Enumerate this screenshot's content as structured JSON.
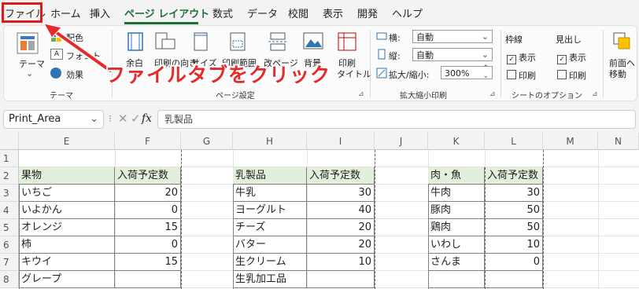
{
  "menu": {
    "tabs": [
      "ファイル",
      "ホーム",
      "挿入",
      "ページ レイアウト",
      "数式",
      "データ",
      "校閲",
      "表示",
      "開発",
      "ヘルプ"
    ],
    "active_tab": "ページ レイアウト"
  },
  "ribbon": {
    "themes": {
      "theme": "テーマ",
      "colors": "配色",
      "fonts": "フォント",
      "effects": "効果",
      "group": "テーマ"
    },
    "page_setup": {
      "margins": "余白",
      "orientation": "印刷の向き",
      "size": "サイズ",
      "print_area": "印刷範囲",
      "breaks": "改ページ",
      "background": "背景",
      "print_titles_1": "印刷",
      "print_titles_2": "タイトル",
      "group": "ページ設定"
    },
    "scale": {
      "width_label": "横:",
      "width_value": "自動",
      "height_label": "縦:",
      "height_value": "自動",
      "scale_label": "拡大/縮小:",
      "scale_value": "300%",
      "group": "拡大縮小印刷"
    },
    "sheet_options": {
      "gridlines": "枠線",
      "headings": "見出し",
      "view": "表示",
      "print": "印刷",
      "group": "シートのオプション"
    },
    "arrange": {
      "bring_forward_1": "前面へ",
      "bring_forward_2": "移動"
    }
  },
  "formula_bar": {
    "name_box": "Print_Area",
    "fx": "fx",
    "content": "乳製品"
  },
  "grid": {
    "columns": [
      "E",
      "F",
      "G",
      "H",
      "I",
      "J",
      "K",
      "L",
      "M",
      "N"
    ],
    "rows": [
      "1",
      "2",
      "3",
      "4",
      "5",
      "6",
      "7",
      "8"
    ],
    "table_fruit": {
      "headers": [
        "果物",
        "入荷予定数"
      ],
      "rows": [
        [
          "いちご",
          "20"
        ],
        [
          "いよかん",
          "0"
        ],
        [
          "オレンジ",
          "15"
        ],
        [
          "柿",
          "0"
        ],
        [
          "キウイ",
          "15"
        ],
        [
          "グレープ",
          ""
        ]
      ]
    },
    "table_dairy": {
      "headers": [
        "乳製品",
        "入荷予定数"
      ],
      "rows": [
        [
          "牛乳",
          "30"
        ],
        [
          "ヨーグルト",
          "40"
        ],
        [
          "チーズ",
          "20"
        ],
        [
          "バター",
          "20"
        ],
        [
          "生クリーム",
          "10"
        ],
        [
          "生乳加工品",
          ""
        ]
      ]
    },
    "table_meat": {
      "headers": [
        "肉・魚",
        "入荷予定数"
      ],
      "rows": [
        [
          "牛肉",
          "30"
        ],
        [
          "豚肉",
          "50"
        ],
        [
          "鶏肉",
          "50"
        ],
        [
          "いわし",
          "10"
        ],
        [
          "さんま",
          "0"
        ],
        [
          "",
          ""
        ]
      ]
    }
  },
  "annotation": {
    "text": "ファイルタブをクリック",
    "color": "#e8292a"
  },
  "colors": {
    "accent": "#1e6e3a",
    "header_fill": "#e2efda",
    "highlight": "#e01b1b"
  }
}
